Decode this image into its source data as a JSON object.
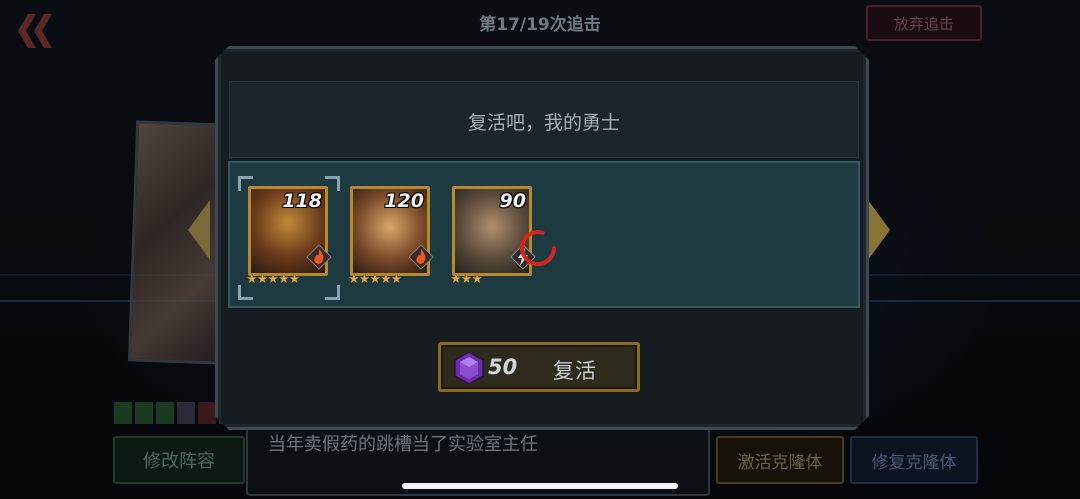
{
  "header": {
    "round_title": "第17/19次追击",
    "abandon_label": "放弃追击"
  },
  "dialog": {
    "title": "复活吧，我的勇士",
    "heroes": [
      {
        "level": "118",
        "stars": 5,
        "element": "fire-icon",
        "selected": true
      },
      {
        "level": "120",
        "stars": 5,
        "element": "fire-icon",
        "selected": false
      },
      {
        "level": "90",
        "stars": 3,
        "element": "lightning-icon",
        "selected": false
      }
    ],
    "revive_button": {
      "cost": "50",
      "label": "复活",
      "currency_icon": "purple-gem-icon"
    }
  },
  "footer": {
    "edit_team_label": "修改阵容",
    "story_text": "当年卖假药的跳槽当了实验室主任",
    "activate_clone_label": "激活克隆体",
    "repair_clone_label": "修复克隆体"
  },
  "colors": {
    "gold": "#b6892e",
    "panel_teal": "#1c3a40",
    "spinner_red": "#d6231c"
  }
}
